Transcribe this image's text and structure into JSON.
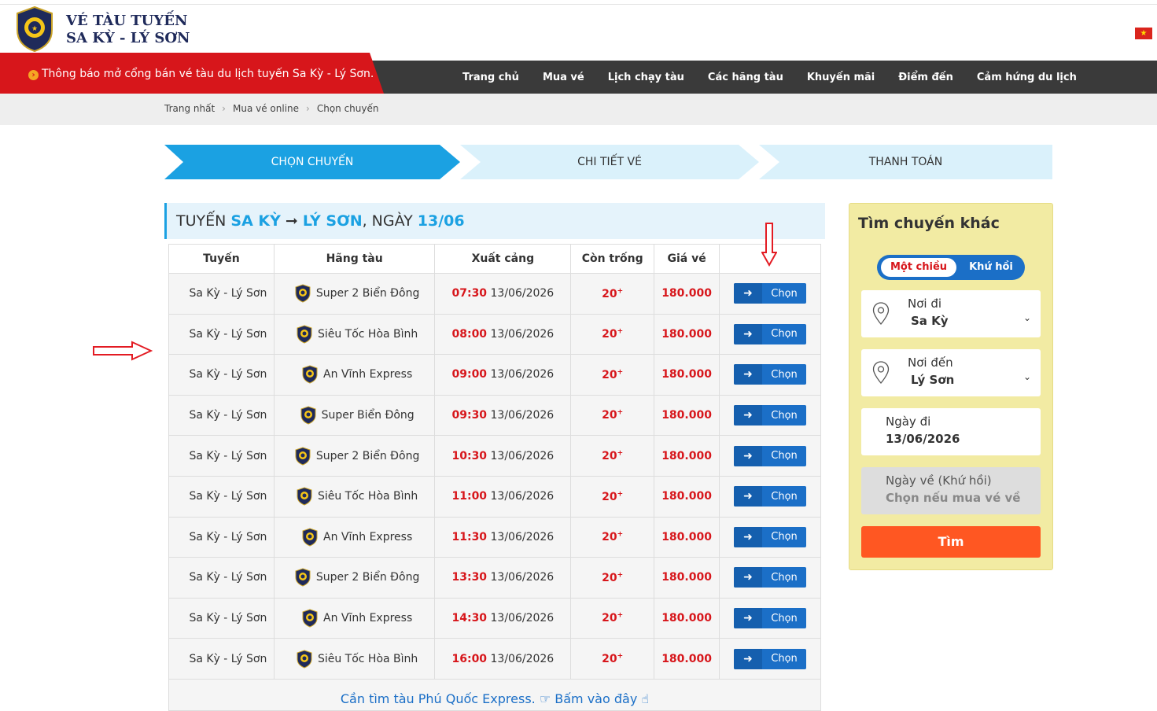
{
  "header": {
    "brand_line1": "VÉ TÀU TUYẾN",
    "brand_line2": "SA KỲ - LÝ SƠN",
    "flag_symbol": "★"
  },
  "notice": {
    "icon": "›",
    "text": "Thông báo mở cổng bán vé tàu du lịch tuyến Sa Kỳ - Lý Sơn."
  },
  "nav": [
    "Trang chủ",
    "Mua vé",
    "Lịch chạy tàu",
    "Các hãng tàu",
    "Khuyến mãi",
    "Điểm đến",
    "Cảm hứng du lịch"
  ],
  "breadcrumb": [
    "Trang nhất",
    "Mua vé online",
    "Chọn chuyến"
  ],
  "breadcrumb_sep": "›",
  "steps": [
    "CHỌN CHUYẾN",
    "CHI TIẾT VÉ",
    "THANH TOÁN"
  ],
  "title": {
    "prefix": "TUYẾN ",
    "from": "SA KỲ",
    "arrow": " ➞ ",
    "to": "LÝ SƠN",
    "mid": ", NGÀY ",
    "date": "13/06"
  },
  "table": {
    "headers": [
      "Tuyến",
      "Hãng tàu",
      "Xuất cảng",
      "Còn trống",
      "Giá vé",
      ""
    ],
    "button_label": "Chọn",
    "button_icon": "➜",
    "rows": [
      {
        "route": "Sa Kỳ - Lý Sơn",
        "company": "Super 2 Biển Đông",
        "time": "07:30",
        "date": "13/06/2026",
        "avail": "20",
        "avail_sup": "+",
        "price": "180.000"
      },
      {
        "route": "Sa Kỳ - Lý Sơn",
        "company": "Siêu Tốc Hòa Bình",
        "time": "08:00",
        "date": "13/06/2026",
        "avail": "20",
        "avail_sup": "+",
        "price": "180.000"
      },
      {
        "route": "Sa Kỳ - Lý Sơn",
        "company": "An Vĩnh Express",
        "time": "09:00",
        "date": "13/06/2026",
        "avail": "20",
        "avail_sup": "+",
        "price": "180.000"
      },
      {
        "route": "Sa Kỳ - Lý Sơn",
        "company": "Super Biển Đông",
        "time": "09:30",
        "date": "13/06/2026",
        "avail": "20",
        "avail_sup": "+",
        "price": "180.000"
      },
      {
        "route": "Sa Kỳ - Lý Sơn",
        "company": "Super 2 Biển Đông",
        "time": "10:30",
        "date": "13/06/2026",
        "avail": "20",
        "avail_sup": "+",
        "price": "180.000"
      },
      {
        "route": "Sa Kỳ - Lý Sơn",
        "company": "Siêu Tốc Hòa Bình",
        "time": "11:00",
        "date": "13/06/2026",
        "avail": "20",
        "avail_sup": "+",
        "price": "180.000"
      },
      {
        "route": "Sa Kỳ - Lý Sơn",
        "company": "An Vĩnh Express",
        "time": "11:30",
        "date": "13/06/2026",
        "avail": "20",
        "avail_sup": "+",
        "price": "180.000"
      },
      {
        "route": "Sa Kỳ - Lý Sơn",
        "company": "Super 2 Biển Đông",
        "time": "13:30",
        "date": "13/06/2026",
        "avail": "20",
        "avail_sup": "+",
        "price": "180.000"
      },
      {
        "route": "Sa Kỳ - Lý Sơn",
        "company": "An Vĩnh Express",
        "time": "14:30",
        "date": "13/06/2026",
        "avail": "20",
        "avail_sup": "+",
        "price": "180.000"
      },
      {
        "route": "Sa Kỳ - Lý Sơn",
        "company": "Siêu Tốc Hòa Bình",
        "time": "16:00",
        "date": "13/06/2026",
        "avail": "20",
        "avail_sup": "+",
        "price": "180.000"
      }
    ]
  },
  "more": {
    "text": "Cần tìm tàu Phú Quốc Express. ",
    "icon1": "☞",
    "link": " Bấm vào đây ",
    "icon2": "☝"
  },
  "sidebar": {
    "title": "Tìm chuyến khác",
    "toggle_one_way": "Một chiều",
    "toggle_round": "Khứ hồi",
    "from_label": "Nơi đi",
    "from_value": "Sa Kỳ",
    "to_label": "Nơi đến",
    "to_value": "Lý Sơn",
    "depart_label": "Ngày đi",
    "depart_value": "13/06/2026",
    "return_label": "Ngày về (Khứ hồi)",
    "return_placeholder": "Chọn nếu mua vé về",
    "search_label": "Tìm",
    "chevron": "⌄"
  },
  "colors": {
    "accent_blue": "#1ba1e2",
    "button_blue": "#1b6fc7",
    "notice_red": "#d7161b",
    "search_orange": "#ff5722",
    "sidebar_bg": "#f2eba3"
  }
}
